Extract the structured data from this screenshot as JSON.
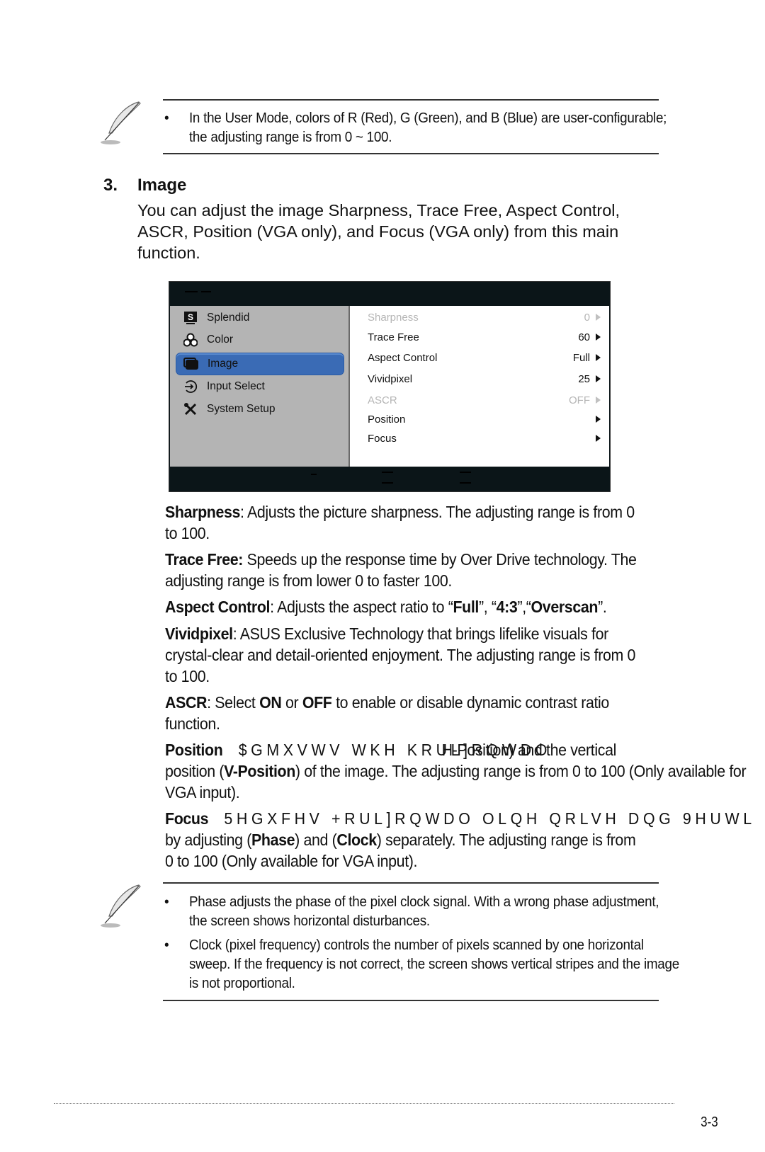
{
  "top_note": {
    "icon": "feather-note-icon",
    "bullets": [
      "In the User Mode, colors of R (Red), G (Green), and B (Blue) are user-configurable; the adjusting range is from 0 ~ 100."
    ]
  },
  "section": {
    "number": "3.",
    "title": "Image",
    "intro": "You can adjust the image Sharpness, Trace Free, Aspect Control, ASCR, Position (VGA only), and Focus (VGA only) from this main function."
  },
  "osd": {
    "colors": {
      "frame": "#0b1518",
      "sidebar": "#b4b4b4",
      "selected": "#3a6bb5",
      "disabled_text": "#b5b5b5"
    },
    "main_menu": [
      {
        "label": "Splendid",
        "icon": "splendid-s-icon",
        "selected": false
      },
      {
        "label": "Color",
        "icon": "rgb-color-icon",
        "selected": false
      },
      {
        "label": "Image",
        "icon": "image-windows-icon",
        "selected": true
      },
      {
        "label": "Input Select",
        "icon": "input-select-icon",
        "selected": false
      },
      {
        "label": "System Setup",
        "icon": "tools-icon",
        "selected": false
      }
    ],
    "sub_menu": [
      {
        "label": "Sharpness",
        "value": "0",
        "disabled": true
      },
      {
        "label": "Trace Free",
        "value": "60",
        "disabled": false
      },
      {
        "label": "Aspect Control",
        "value": "Full",
        "disabled": false
      },
      {
        "label": "Vividpixel",
        "value": "25",
        "disabled": false
      },
      {
        "label": "ASCR",
        "value": "OFF",
        "disabled": true
      },
      {
        "label": "Position",
        "value": "",
        "disabled": false
      },
      {
        "label": "Focus",
        "value": "",
        "disabled": false
      }
    ]
  },
  "descriptions": {
    "sharpness": {
      "term": "Sharpness",
      "text": ": Adjusts the picture sharpness. The adjusting range is from 0 to 100."
    },
    "trace_free": {
      "term": "Trace Free:",
      "text": " Speeds up the response time by Over Drive technology. The adjusting range is from lower 0 to faster 100."
    },
    "aspect": {
      "term": "Aspect Control",
      "t1": ": Adjusts the aspect ratio to “",
      "o1": "Full",
      "t2": "”, “",
      "o2": "4:3",
      "t3": "”,“",
      "o3": "Overscan",
      "t4": "”."
    },
    "vividpixel": {
      "term": "Vividpixel",
      "text": ": ASUS Exclusive Technology that brings lifelike visuals for crystal-clear and detail-oriented enjoyment. The adjusting range is from 0 to 100."
    },
    "ascr": {
      "term": "ASCR",
      "t1": ": Select ",
      "on": "ON",
      "t2": " or ",
      "off": "OFF",
      "t3": " to enable or disable dynamic contrast ratio function."
    },
    "position": {
      "term": "Position",
      "garbled": "$GMXVWV WKH KRUL]RQWDO",
      "overlap": "H-Position) and the vertical",
      "t1": "position (",
      "v": "V-Position",
      "t2": ") of the image. The adjusting range is from 0 to 100 (Only available for VGA input)."
    },
    "focus": {
      "term": "Focus",
      "garbled": "5HGXFHV +RUL]RQWDO OLQH QRLVH DQG 9HUWL",
      "t1": "by adjusting (",
      "phase": "Phase",
      "t2": ") and (",
      "clock": "Clock",
      "t3": ") separately. The adjusting range is from 0 to 100 (Only available for VGA input)."
    }
  },
  "bottom_note": {
    "icon": "feather-note-icon",
    "bullets": [
      "Phase adjusts the phase of the pixel clock signal. With a wrong phase adjustment, the screen shows horizontal disturbances.",
      "Clock (pixel frequency) controls the number of pixels scanned by one horizontal sweep. If the frequency is not correct, the screen shows vertical stripes and the image is not proportional."
    ]
  },
  "bullet_char": "•",
  "page_number": "3-3"
}
